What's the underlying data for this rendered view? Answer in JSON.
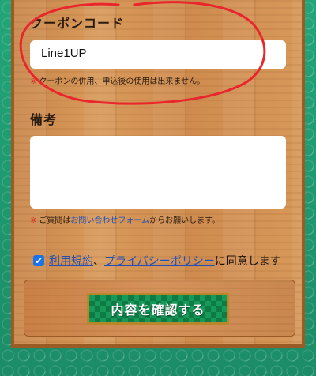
{
  "form": {
    "coupon": {
      "title": "クーポンコード",
      "value": "Line1UP",
      "note_mark": "※",
      "note": "クーポンの併用、申込後の使用は出来ません。"
    },
    "memo": {
      "title": "備考",
      "value": "",
      "note_mark": "※",
      "note_prefix": "ご質問は",
      "note_link": "お問い合わせフォーム",
      "note_suffix": "からお願いします。"
    },
    "agreement": {
      "checked": true,
      "terms_link": "利用規約",
      "separator": "、",
      "privacy_link": "プライバシーポリシー",
      "suffix": "に同意します"
    },
    "submit_label": "内容を確認する"
  },
  "colors": {
    "annotation": "#e8262c",
    "background": "#1f8f6a",
    "button": "#0e7a44",
    "link": "#2350b8"
  }
}
